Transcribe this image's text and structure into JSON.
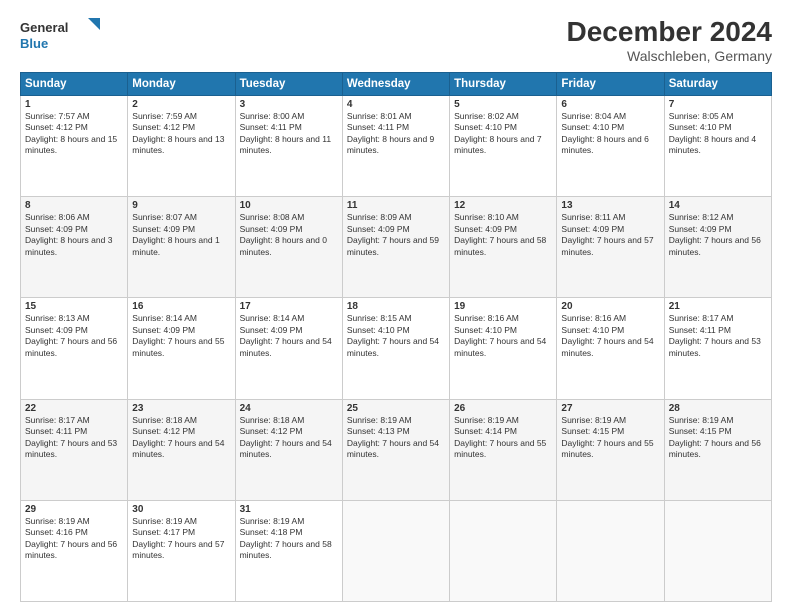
{
  "header": {
    "logo": "GeneralBlue",
    "month": "December 2024",
    "location": "Walschleben, Germany"
  },
  "days_of_week": [
    "Sunday",
    "Monday",
    "Tuesday",
    "Wednesday",
    "Thursday",
    "Friday",
    "Saturday"
  ],
  "weeks": [
    [
      {
        "day": "1",
        "sunrise": "7:57 AM",
        "sunset": "4:12 PM",
        "daylight": "8 hours and 15 minutes."
      },
      {
        "day": "2",
        "sunrise": "7:59 AM",
        "sunset": "4:12 PM",
        "daylight": "8 hours and 13 minutes."
      },
      {
        "day": "3",
        "sunrise": "8:00 AM",
        "sunset": "4:11 PM",
        "daylight": "8 hours and 11 minutes."
      },
      {
        "day": "4",
        "sunrise": "8:01 AM",
        "sunset": "4:11 PM",
        "daylight": "8 hours and 9 minutes."
      },
      {
        "day": "5",
        "sunrise": "8:02 AM",
        "sunset": "4:10 PM",
        "daylight": "8 hours and 7 minutes."
      },
      {
        "day": "6",
        "sunrise": "8:04 AM",
        "sunset": "4:10 PM",
        "daylight": "8 hours and 6 minutes."
      },
      {
        "day": "7",
        "sunrise": "8:05 AM",
        "sunset": "4:10 PM",
        "daylight": "8 hours and 4 minutes."
      }
    ],
    [
      {
        "day": "8",
        "sunrise": "8:06 AM",
        "sunset": "4:09 PM",
        "daylight": "8 hours and 3 minutes."
      },
      {
        "day": "9",
        "sunrise": "8:07 AM",
        "sunset": "4:09 PM",
        "daylight": "8 hours and 1 minute."
      },
      {
        "day": "10",
        "sunrise": "8:08 AM",
        "sunset": "4:09 PM",
        "daylight": "8 hours and 0 minutes."
      },
      {
        "day": "11",
        "sunrise": "8:09 AM",
        "sunset": "4:09 PM",
        "daylight": "7 hours and 59 minutes."
      },
      {
        "day": "12",
        "sunrise": "8:10 AM",
        "sunset": "4:09 PM",
        "daylight": "7 hours and 58 minutes."
      },
      {
        "day": "13",
        "sunrise": "8:11 AM",
        "sunset": "4:09 PM",
        "daylight": "7 hours and 57 minutes."
      },
      {
        "day": "14",
        "sunrise": "8:12 AM",
        "sunset": "4:09 PM",
        "daylight": "7 hours and 56 minutes."
      }
    ],
    [
      {
        "day": "15",
        "sunrise": "8:13 AM",
        "sunset": "4:09 PM",
        "daylight": "7 hours and 56 minutes."
      },
      {
        "day": "16",
        "sunrise": "8:14 AM",
        "sunset": "4:09 PM",
        "daylight": "7 hours and 55 minutes."
      },
      {
        "day": "17",
        "sunrise": "8:14 AM",
        "sunset": "4:09 PM",
        "daylight": "7 hours and 54 minutes."
      },
      {
        "day": "18",
        "sunrise": "8:15 AM",
        "sunset": "4:10 PM",
        "daylight": "7 hours and 54 minutes."
      },
      {
        "day": "19",
        "sunrise": "8:16 AM",
        "sunset": "4:10 PM",
        "daylight": "7 hours and 54 minutes."
      },
      {
        "day": "20",
        "sunrise": "8:16 AM",
        "sunset": "4:10 PM",
        "daylight": "7 hours and 54 minutes."
      },
      {
        "day": "21",
        "sunrise": "8:17 AM",
        "sunset": "4:11 PM",
        "daylight": "7 hours and 53 minutes."
      }
    ],
    [
      {
        "day": "22",
        "sunrise": "8:17 AM",
        "sunset": "4:11 PM",
        "daylight": "7 hours and 53 minutes."
      },
      {
        "day": "23",
        "sunrise": "8:18 AM",
        "sunset": "4:12 PM",
        "daylight": "7 hours and 54 minutes."
      },
      {
        "day": "24",
        "sunrise": "8:18 AM",
        "sunset": "4:12 PM",
        "daylight": "7 hours and 54 minutes."
      },
      {
        "day": "25",
        "sunrise": "8:19 AM",
        "sunset": "4:13 PM",
        "daylight": "7 hours and 54 minutes."
      },
      {
        "day": "26",
        "sunrise": "8:19 AM",
        "sunset": "4:14 PM",
        "daylight": "7 hours and 55 minutes."
      },
      {
        "day": "27",
        "sunrise": "8:19 AM",
        "sunset": "4:15 PM",
        "daylight": "7 hours and 55 minutes."
      },
      {
        "day": "28",
        "sunrise": "8:19 AM",
        "sunset": "4:15 PM",
        "daylight": "7 hours and 56 minutes."
      }
    ],
    [
      {
        "day": "29",
        "sunrise": "8:19 AM",
        "sunset": "4:16 PM",
        "daylight": "7 hours and 56 minutes."
      },
      {
        "day": "30",
        "sunrise": "8:19 AM",
        "sunset": "4:17 PM",
        "daylight": "7 hours and 57 minutes."
      },
      {
        "day": "31",
        "sunrise": "8:19 AM",
        "sunset": "4:18 PM",
        "daylight": "7 hours and 58 minutes."
      },
      null,
      null,
      null,
      null
    ]
  ]
}
